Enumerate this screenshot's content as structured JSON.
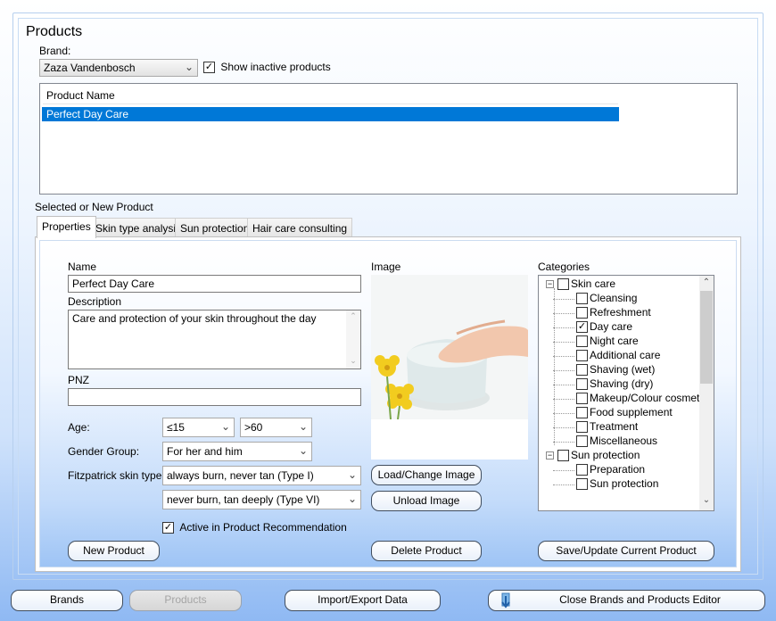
{
  "page": {
    "title": "Products"
  },
  "brand": {
    "label": "Brand:",
    "selected": "Zaza Vandenbosch",
    "show_inactive_label": "Show inactive products",
    "show_inactive_checked": true
  },
  "product_list": {
    "header": "Product Name",
    "rows": [
      "Perfect Day Care"
    ]
  },
  "selected_section_label": "Selected or New Product",
  "tabs": [
    {
      "label": "Properties",
      "active": true
    },
    {
      "label": "Skin type analysis",
      "active": false
    },
    {
      "label": "Sun protection",
      "active": false
    },
    {
      "label": "Hair care consulting",
      "active": false
    }
  ],
  "properties": {
    "name_label": "Name",
    "name_value": "Perfect Day Care",
    "description_label": "Description",
    "description_value": "Care and protection of your skin throughout the day",
    "pnz_label": "PNZ",
    "pnz_value": "",
    "age_label": "Age:",
    "age_min": "≤15",
    "age_max": ">60",
    "gender_label": "Gender Group:",
    "gender_value": "For her and him",
    "fitzpatrick_label": "Fitzpatrick skin type:",
    "fitzpatrick_min": "always burn, never tan (Type I)",
    "fitzpatrick_max": "never burn,  tan deeply (Type VI)",
    "active_label": "Active in Product Recommendation",
    "active_checked": true,
    "image_label": "Image",
    "load_image_button": "Load/Change Image",
    "unload_image_button": "Unload Image",
    "categories_label": "Categories"
  },
  "categories": [
    {
      "label": "Skin care",
      "level": 0,
      "checked": false,
      "expander": "−"
    },
    {
      "label": "Cleansing",
      "level": 1,
      "checked": false
    },
    {
      "label": "Refreshment",
      "level": 1,
      "checked": false
    },
    {
      "label": "Day care",
      "level": 1,
      "checked": true
    },
    {
      "label": "Night care",
      "level": 1,
      "checked": false
    },
    {
      "label": "Additional care",
      "level": 1,
      "checked": false
    },
    {
      "label": "Shaving (wet)",
      "level": 1,
      "checked": false
    },
    {
      "label": "Shaving (dry)",
      "level": 1,
      "checked": false
    },
    {
      "label": "Makeup/Colour cosmetics",
      "level": 1,
      "checked": false
    },
    {
      "label": "Food supplement",
      "level": 1,
      "checked": false
    },
    {
      "label": "Treatment",
      "level": 1,
      "checked": false
    },
    {
      "label": "Miscellaneous",
      "level": 1,
      "checked": false
    },
    {
      "label": "Sun protection",
      "level": 0,
      "checked": false,
      "expander": "−"
    },
    {
      "label": "Preparation",
      "level": 1,
      "checked": false
    },
    {
      "label": "Sun protection",
      "level": 1,
      "checked": false
    }
  ],
  "actions": {
    "new_product": "New Product",
    "delete_product": "Delete Product",
    "save_product": "Save/Update Current Product"
  },
  "bottom_bar": {
    "brands": "Brands",
    "products": "Products",
    "import_export": "Import/Export Data",
    "close_editor": "Close Brands and Products Editor"
  }
}
